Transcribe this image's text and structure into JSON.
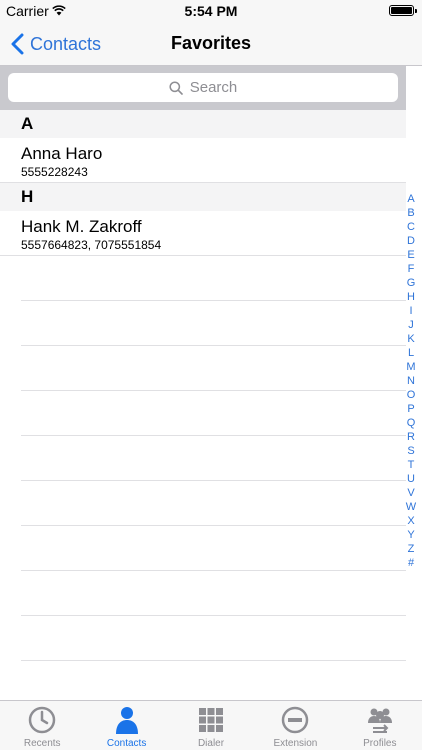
{
  "status": {
    "carrier": "Carrier",
    "time": "5:54 PM"
  },
  "nav": {
    "back_label": "Contacts",
    "title": "Favorites"
  },
  "search": {
    "placeholder": "Search"
  },
  "sections": [
    {
      "letter": "A",
      "contacts": [
        {
          "name": "Anna Haro",
          "phones": "5555228243"
        }
      ]
    },
    {
      "letter": "H",
      "contacts": [
        {
          "name": "Hank M. Zakroff",
          "phones": "5557664823, 7075551854"
        }
      ]
    }
  ],
  "index_letters": [
    "A",
    "B",
    "C",
    "D",
    "E",
    "F",
    "G",
    "H",
    "I",
    "J",
    "K",
    "L",
    "M",
    "N",
    "O",
    "P",
    "Q",
    "R",
    "S",
    "T",
    "U",
    "V",
    "W",
    "X",
    "Y",
    "Z",
    "#"
  ],
  "tabs": [
    {
      "label": "Recents",
      "icon": "clock-icon",
      "active": false
    },
    {
      "label": "Contacts",
      "icon": "person-icon",
      "active": true
    },
    {
      "label": "Dialer",
      "icon": "keypad-icon",
      "active": false
    },
    {
      "label": "Extension",
      "icon": "minus-circle-icon",
      "active": false
    },
    {
      "label": "Profiles",
      "icon": "profiles-icon",
      "active": false
    }
  ],
  "colors": {
    "accent": "#1a73e8",
    "index": "#2f74d8",
    "inactive": "#8e8e93"
  }
}
